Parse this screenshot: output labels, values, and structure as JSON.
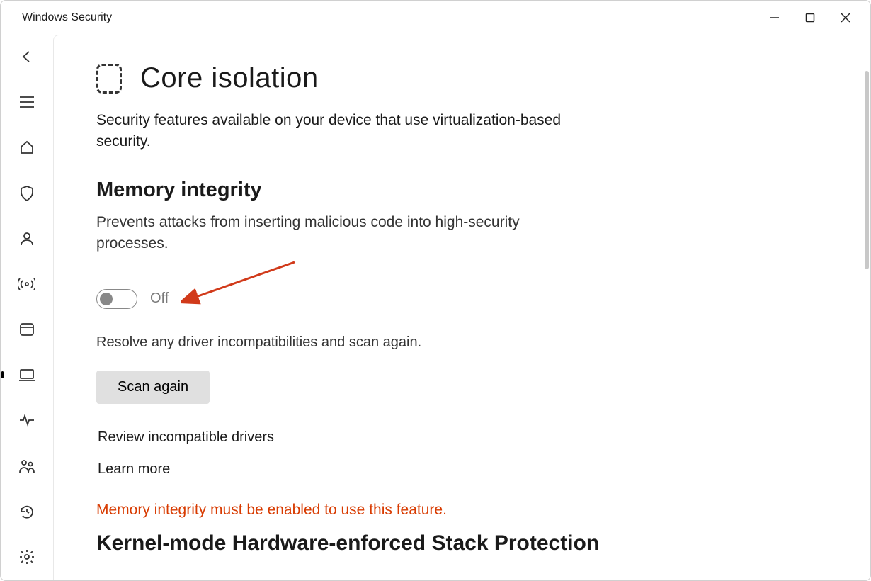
{
  "window": {
    "title": "Windows Security"
  },
  "page": {
    "title": "Core isolation",
    "subtitle": "Security features available on your device that use virtualization-based security."
  },
  "memory_integrity": {
    "title": "Memory integrity",
    "description": "Prevents attacks from inserting malicious code into high-security processes.",
    "toggle_state": "Off",
    "resolve_text": "Resolve any driver incompatibilities and scan again.",
    "scan_button": "Scan again",
    "link_review": "Review incompatible drivers",
    "link_learn": "Learn more"
  },
  "warning": "Memory integrity must be enabled to use this feature.",
  "next_section_title": "Kernel-mode Hardware-enforced Stack Protection",
  "sidebar": {
    "back": "back",
    "menu": "menu",
    "home": "home",
    "shield": "virus-protection",
    "account": "account-protection",
    "network": "firewall-network",
    "app": "app-browser-control",
    "device": "device-security",
    "performance": "device-performance",
    "family": "family-options",
    "history": "protection-history",
    "settings": "settings"
  }
}
